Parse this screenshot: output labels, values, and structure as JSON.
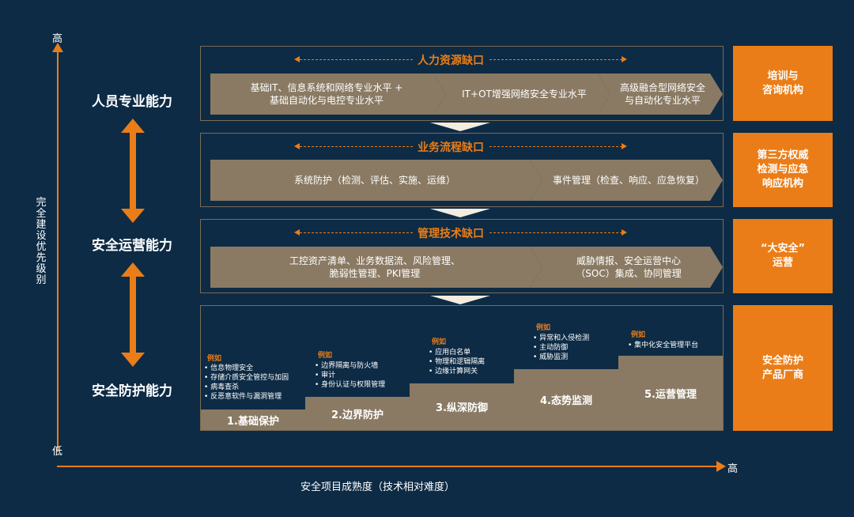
{
  "axes": {
    "y_high": "高",
    "y_low": "低",
    "y_title": "完全建设优先级别",
    "x_high": "高",
    "x_title": "安全项目成熟度（技术相对难度）"
  },
  "capabilities": [
    "人员专业能力",
    "安全运营能力",
    "安全防护能力"
  ],
  "sections": {
    "hr": {
      "title": "人力资源缺口",
      "chevrons": [
        "基础IT、信息系统和网络专业水平 +\n基础自动化与电控专业水平",
        "IT+OT增强网络安全专业水平",
        "高级融合型网络安全\n与自动化专业水平"
      ]
    },
    "process": {
      "title": "业务流程缺口",
      "chevrons": [
        "系统防护（检测、评估、实施、运维）",
        "事件管理（检查、响应、应急恢复）"
      ]
    },
    "mgmt": {
      "title": "管理技术缺口",
      "chevrons": [
        "工控资产清单、业务数据流、风险管理、\n脆弱性管理、PKI管理",
        "威胁情报、安全运营中心\n（SOC）集成、协同管理"
      ]
    }
  },
  "steps": [
    {
      "label": "1.基础保护",
      "example_title": "例如",
      "items": [
        "信息物理安全",
        "存储介质安全管控与加固",
        "病毒查杀",
        "反恶意软件与漏洞管理"
      ]
    },
    {
      "label": "2.边界防护",
      "example_title": "例如",
      "items": [
        "边界隔离与防火墙",
        "审计",
        "身份认证与权限管理"
      ]
    },
    {
      "label": "3.纵深防御",
      "example_title": "例如",
      "items": [
        "应用白名单",
        "物理和逻辑隔离",
        "边缘计算网关"
      ]
    },
    {
      "label": "4.态势监测",
      "example_title": "例如",
      "items": [
        "异常和入侵检测",
        "主动防御",
        "威胁监测"
      ]
    },
    {
      "label": "5.运营管理",
      "example_title": "例如",
      "items": [
        "集中化安全管理平台"
      ]
    }
  ],
  "orange_boxes": [
    "培训与\n咨询机构",
    "第三方权威\n检测与应急\n响应机构",
    "“大安全”\n运营",
    "安全防护\n产品厂商"
  ],
  "colors": {
    "background": "#0d2b45",
    "accent": "#ea7d17",
    "block": "#8a7a63"
  }
}
